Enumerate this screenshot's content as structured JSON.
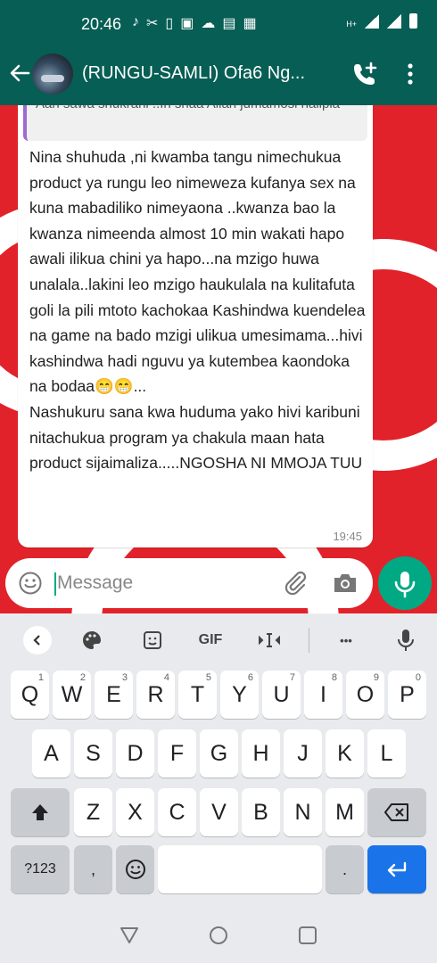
{
  "status_bar": {
    "time": "20:46",
    "icons": [
      "tiktok-icon",
      "missed-call-icon",
      "sim-icon",
      "gallery-icon",
      "cloud-icon",
      "news-icon",
      "calendar-icon"
    ],
    "network": "H+"
  },
  "chat": {
    "title": "(RUNGU-SAMLI) Ofa6 Ng...",
    "accent": "#075e54"
  },
  "message": {
    "quoted_text": "Aah sawa shukrani ..In shaa Allah jumamosi nalipia",
    "text": "Nina shuhuda ,ni kwamba tangu nimechukua product ya rungu leo nimeweza kufanya sex na kuna mabadiliko nimeyaona ..kwanza bao la kwanza nimeenda almost 10 min wakati hapo awali ilikua chini ya hapo...na mzigo huwa unalala..lakini leo mzigo haukulala na kulitafuta goli la pili mtoto kachokaa Kashindwa kuendelea   na game na bado mzigi ulikua umesimama...hivi kashindwa hadi nguvu ya kutembea kaondoka na bodaa😁😁...\nNashukuru sana kwa huduma yako hivi karibuni nitachukua program ya chakula maan hata product sijaimaliza.....NGOSHA NI MMOJA TUU",
    "time": "19:45"
  },
  "composer": {
    "placeholder": "Message"
  },
  "keyboard": {
    "toolbar": {
      "gif_label": "GIF",
      "more_label": "•••"
    },
    "row1": [
      {
        "k": "Q",
        "h": "1"
      },
      {
        "k": "W",
        "h": "2"
      },
      {
        "k": "E",
        "h": "3"
      },
      {
        "k": "R",
        "h": "4"
      },
      {
        "k": "T",
        "h": "5"
      },
      {
        "k": "Y",
        "h": "6"
      },
      {
        "k": "U",
        "h": "7"
      },
      {
        "k": "I",
        "h": "8"
      },
      {
        "k": "O",
        "h": "9"
      },
      {
        "k": "P",
        "h": "0"
      }
    ],
    "row2": [
      "A",
      "S",
      "D",
      "F",
      "G",
      "H",
      "J",
      "K",
      "L"
    ],
    "row3": [
      "Z",
      "X",
      "C",
      "V",
      "B",
      "N",
      "M"
    ],
    "symbols_label": "?123",
    "comma_label": ",",
    "period_label": "."
  }
}
